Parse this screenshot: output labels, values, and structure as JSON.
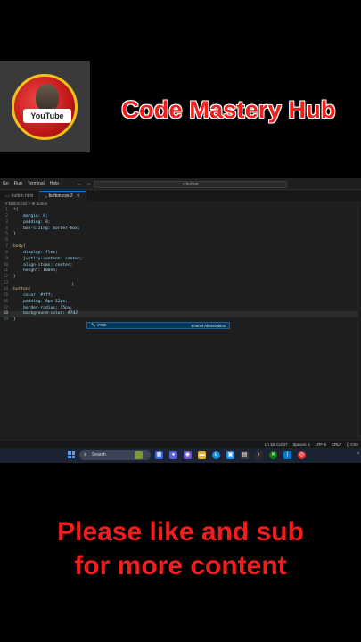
{
  "banner": {
    "channel_name": "Code Mastery Hub",
    "logo_text": "YouTube"
  },
  "vscode": {
    "menu": [
      "Go",
      "Run",
      "Terminal",
      "Help"
    ],
    "search_placeholder": "button",
    "tabs": [
      {
        "label": "button.html",
        "icon": "html-icon",
        "active": false
      },
      {
        "label": "button.css 2",
        "icon": "css-icon",
        "active": true
      }
    ],
    "breadcrumb": "# button.css > ⚙ button",
    "code_lines": [
      {
        "n": "1",
        "text": "*{"
      },
      {
        "n": "2",
        "text": "    margin: 0;"
      },
      {
        "n": "3",
        "text": "    padding: 0;"
      },
      {
        "n": "4",
        "text": "    box-sizing: border-box;"
      },
      {
        "n": "5",
        "text": "}"
      },
      {
        "n": "6",
        "text": ""
      },
      {
        "n": "7",
        "text": "body{"
      },
      {
        "n": "8",
        "text": "    display: flex;"
      },
      {
        "n": "9",
        "text": "    justify-content: center;"
      },
      {
        "n": "10",
        "text": "    align-items: center;"
      },
      {
        "n": "11",
        "text": "    height: 100vh;"
      },
      {
        "n": "12",
        "text": "}"
      },
      {
        "n": "13",
        "text": ""
      },
      {
        "n": "14",
        "text": "button{"
      },
      {
        "n": "15",
        "text": "    color: #fff;"
      },
      {
        "n": "16",
        "text": "    padding: 8px 22px;"
      },
      {
        "n": "17",
        "text": "    border-radius: 15px;"
      },
      {
        "n": "18",
        "text": "    background-color: #7d2"
      },
      {
        "n": "19",
        "text": "}"
      }
    ],
    "current_line": "18",
    "suggestion": {
      "label": "#7d2",
      "detail": "Emmet Abbreviation"
    },
    "status": [
      "Ln 18, Col 27",
      "Spaces: 4",
      "UTF-8",
      "CRLF",
      "{} CSS"
    ]
  },
  "taskbar": {
    "search_label": "Search",
    "icons": [
      "widgets-icon",
      "files-icon",
      "chat-icon",
      "meet-icon",
      "explorer-icon",
      "edge-icon",
      "photos-icon",
      "store-icon",
      "terminal-icon",
      "xbox-icon",
      "vscode-icon",
      "chrome-icon"
    ],
    "tray_text": "^"
  },
  "caption": {
    "line1": "Please like and sub",
    "line2": "for more content"
  },
  "colors": {
    "brand_red": "#f01e1e",
    "editor_bg": "#1e1e1e",
    "accent_blue": "#0078d4"
  }
}
